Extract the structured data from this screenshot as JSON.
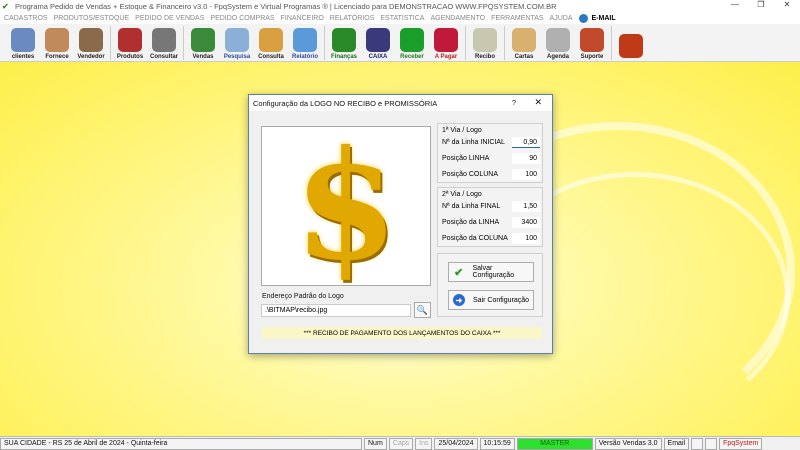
{
  "window": {
    "title": "Programa Pedido de Vendas + Estoque & Financeiro v3.0 - FpqSystem e Virtual Programas ® | Licenciado para  DEMONSTRACAO WWW.FPQSYSTEM.COM.BR",
    "minimize": "—",
    "maximize": "❐",
    "close": "✕"
  },
  "menu": [
    "CADASTROS",
    "PRODUTOS/ESTOQUE",
    "PEDIDO DE VENDAS",
    "PEDIDO COMPRAS",
    "FINANCEIRO",
    "RELATÓRIOS",
    "ESTATISTICA",
    "AGENDAMENTO",
    "FERRAMENTAS",
    "AJUDA"
  ],
  "menu_email": "E-MAIL",
  "toolbar": [
    {
      "label": "clientes",
      "color": "#6a8ac0",
      "text": "#222"
    },
    {
      "label": "Fornece",
      "color": "#c08a5a",
      "text": "#222"
    },
    {
      "label": "Vendedor",
      "color": "#8a6a4a",
      "text": "#222"
    },
    {
      "sep": true
    },
    {
      "label": "Produtos",
      "color": "#b03030",
      "text": "#222"
    },
    {
      "label": "Consultar",
      "color": "#777",
      "text": "#222"
    },
    {
      "sep": true
    },
    {
      "label": "Vendas",
      "color": "#3a8a3a",
      "text": "#222"
    },
    {
      "label": "Pesquisa",
      "color": "#8ab0d8",
      "text": "#2a4aa0"
    },
    {
      "label": "Consulta",
      "color": "#d8a040",
      "text": "#222"
    },
    {
      "label": "Relatório",
      "color": "#5a9ad8",
      "text": "#2a4aa0"
    },
    {
      "sep": true
    },
    {
      "label": "Finanças",
      "color": "#2a8a2a",
      "text": "#1a6a1a"
    },
    {
      "label": "CAIXA",
      "color": "#3a3a7a",
      "text": "#1a1a6a"
    },
    {
      "label": "Receber",
      "color": "#1aa02a",
      "text": "#1a7a1a"
    },
    {
      "label": "A Pagar",
      "color": "#c01a3a",
      "text": "#c01a1a"
    },
    {
      "sep": true
    },
    {
      "label": "Recibo",
      "color": "#c8c8b0",
      "text": "#222"
    },
    {
      "sep": true
    },
    {
      "label": "Cartas",
      "color": "#d8b070",
      "text": "#222"
    },
    {
      "label": "Agenda",
      "color": "#b0b0b0",
      "text": "#222"
    },
    {
      "label": "Suporte",
      "color": "#c04a2a",
      "text": "#222"
    },
    {
      "sep": true
    },
    {
      "label": "",
      "color": "#c03a1a",
      "text": "#222"
    }
  ],
  "dialog": {
    "title": "Configuração da LOGO NO RECIBO e PROMISSÓRIA",
    "help": "?",
    "close": "✕",
    "logo_symbol": "$",
    "path_label": "Endereço Padrão do Logo",
    "path_value": ".\\BITMAP\\recibo.jpg",
    "group1": {
      "title": "1ª Via / Logo",
      "rows": [
        {
          "label": "Nª da Linha INICIAL",
          "value": "0,90"
        },
        {
          "label": "Posição LINHA",
          "value": "90"
        },
        {
          "label": "Posição COLUNA",
          "value": "100"
        }
      ]
    },
    "group2": {
      "title": "2ª Via / Logo",
      "rows": [
        {
          "label": "Nª da Linha FINAL",
          "value": "1,50"
        },
        {
          "label": "Posição da LINHA",
          "value": "3400"
        },
        {
          "label": "Posição da COLUNA",
          "value": "100"
        }
      ]
    },
    "save_label": "Salvar Configuração",
    "exit_label": "Sair Configuração",
    "footer": "*** RECIBO DE PAGAMENTO DOS LANÇAMENTOS DO CAIXA ***"
  },
  "status": {
    "city": "SUA CIDADE - RS 25 de Abril de 2024 - Quinta-feira",
    "num": "Num",
    "caps": "Caps",
    "ins": "Ins",
    "date": "25/04/2024",
    "time": "10:15:59",
    "user": "MASTER",
    "version": "Versão Vendas 3.0",
    "email": "Email",
    "brand": "FpqSystem"
  }
}
